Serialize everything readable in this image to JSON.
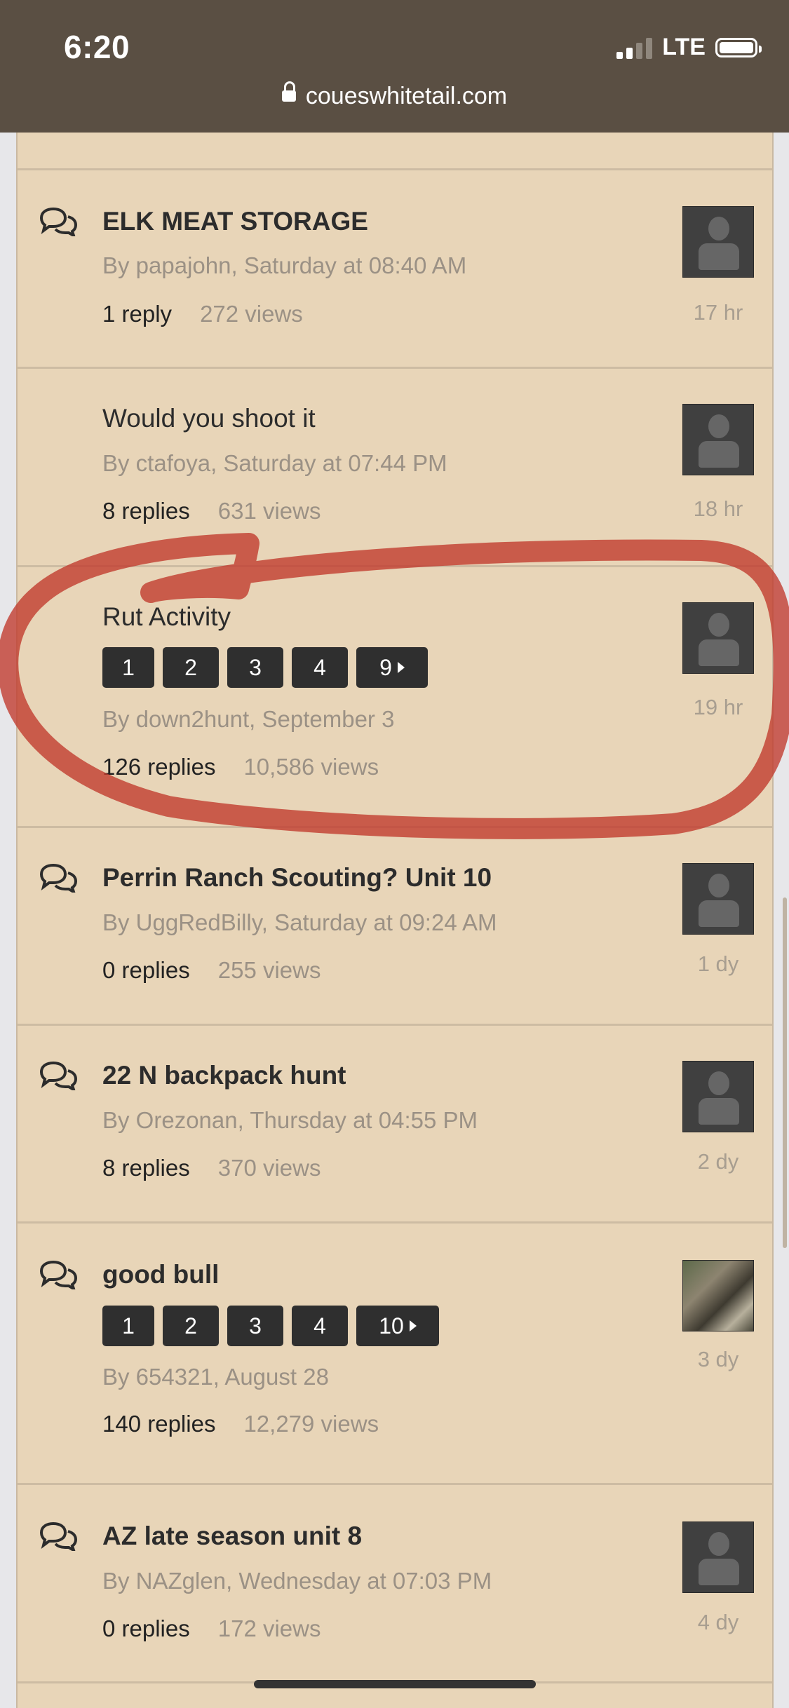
{
  "status_bar": {
    "time": "6:20",
    "network": "LTE"
  },
  "url_bar": {
    "domain": "coueswhitetail.com"
  },
  "topics": [
    {
      "title": "ELK MEAT STORAGE",
      "meta": "By papajohn, Saturday at 08:40 AM",
      "replies": "1 reply",
      "views": "272 views",
      "ago": "17 hr"
    },
    {
      "title": "Would you shoot it",
      "meta": "By ctafoya, Saturday at 07:44 PM",
      "replies": "8 replies",
      "views": "631 views",
      "ago": "18 hr"
    },
    {
      "title": "Rut Activity",
      "pages": [
        "1",
        "2",
        "3",
        "4",
        "9"
      ],
      "meta": "By down2hunt, September 3",
      "replies": "126 replies",
      "views": "10,586 views",
      "ago": "19 hr"
    },
    {
      "title": "Perrin Ranch Scouting? Unit 10",
      "meta": "By UggRedBilly, Saturday at 09:24 AM",
      "replies": "0 replies",
      "views": "255 views",
      "ago": "1 dy"
    },
    {
      "title": "22 N backpack hunt",
      "meta": "By Orezonan, Thursday at 04:55 PM",
      "replies": "8 replies",
      "views": "370 views",
      "ago": "2 dy"
    },
    {
      "title": "good bull",
      "pages": [
        "1",
        "2",
        "3",
        "4",
        "10"
      ],
      "meta": "By 654321, August 28",
      "replies": "140 replies",
      "views": "12,279 views",
      "ago": "3 dy"
    },
    {
      "title": "AZ late season unit 8",
      "meta": "By NAZglen, Wednesday at 07:03 PM",
      "replies": "0 replies",
      "views": "172 views",
      "ago": "4 dy"
    }
  ],
  "colors": {
    "status_bar": "#5a4f43",
    "content_bg": "#e8d5b8",
    "page_button": "#2f2f2f",
    "annotation_red": "#c0392b"
  }
}
